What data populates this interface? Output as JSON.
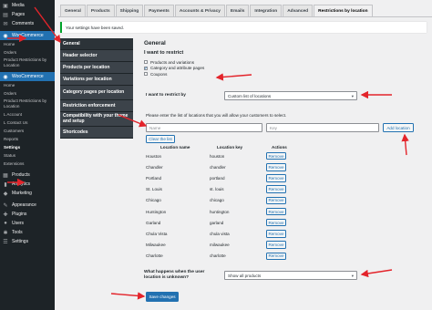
{
  "admin_menu": {
    "top_items": [
      {
        "label": "Media",
        "icon": "media-icon"
      },
      {
        "label": "Pages",
        "icon": "pages-icon"
      },
      {
        "label": "Comments",
        "icon": "comments-icon"
      }
    ],
    "woo_group_1": {
      "label": "WooCommerce",
      "subitems": [
        "Home",
        "Orders",
        "Product Restrictions by Location"
      ]
    },
    "woo_group_2": {
      "label": "WooCommerce",
      "subitems": [
        "Home",
        "Orders",
        "Product Restrictions by Location",
        "L Account",
        "L Contact Us",
        "Customers",
        "Reports",
        "Settings",
        "Status",
        "Extensions"
      ]
    },
    "bottom_items": [
      {
        "label": "Products",
        "icon": "products-icon"
      },
      {
        "label": "Analytics",
        "icon": "analytics-icon"
      },
      {
        "label": "Marketing",
        "icon": "marketing-icon"
      },
      {
        "label": "Appearance",
        "icon": "appearance-icon"
      },
      {
        "label": "Plugins",
        "icon": "plugins-icon"
      },
      {
        "label": "Users",
        "icon": "users-icon"
      },
      {
        "label": "Tools",
        "icon": "tools-icon"
      },
      {
        "label": "Settings",
        "icon": "settings-icon"
      }
    ]
  },
  "tabs": [
    "General",
    "Products",
    "Shipping",
    "Payments",
    "Accounts & Privacy",
    "Emails",
    "Integration",
    "Advanced",
    "Restrictions by location"
  ],
  "active_tab_index": 8,
  "notice": "Your settings have been saved.",
  "settings_menu": [
    "General",
    "Header selector",
    "Products per location",
    "Variations per location",
    "Category pages per location",
    "Restriction enforcement",
    "Compatibility with your theme and setup",
    "Shortcodes"
  ],
  "main": {
    "section_title": "General",
    "restrict_heading": "I want to restrict",
    "restrict_options": [
      {
        "label": "Products and variations",
        "checked": false
      },
      {
        "label": "Category and attribute pages",
        "checked": true
      },
      {
        "label": "Coupons",
        "checked": false
      }
    ],
    "restrict_by_label": "I want to restrict by",
    "restrict_by_value": "Custom list of locations",
    "location_hint": "Please enter the list of locations that you will allow your customers to select.",
    "name_placeholder": "Name",
    "key_placeholder": "Key",
    "add_location_label": "Add location",
    "clear_list_label": "Clear the list",
    "table_headers": [
      "Location name",
      "Location key",
      "Actions"
    ],
    "locations": [
      {
        "name": "Houston",
        "key": "houston"
      },
      {
        "name": "Chandler",
        "key": "chandler"
      },
      {
        "name": "Portland",
        "key": "portland"
      },
      {
        "name": "St. Louis",
        "key": "st. louis"
      },
      {
        "name": "Chicago",
        "key": "chicago"
      },
      {
        "name": "Huntington",
        "key": "huntington"
      },
      {
        "name": "Garland",
        "key": "garland"
      },
      {
        "name": "Chula Vista",
        "key": "chula vista"
      },
      {
        "name": "Milwaukee",
        "key": "milwaukee"
      },
      {
        "name": "Charlotte",
        "key": "charlotte"
      }
    ],
    "remove_label": "Remove",
    "unknown_label": "What happens when the user location is unknown?",
    "unknown_value": "Show all products",
    "save_label": "Save changes"
  },
  "colors": {
    "sidebar_bg": "#1d2327",
    "accent": "#2271b1",
    "annotation_arrow": "#e3242b",
    "notice_border": "#00a32a"
  }
}
